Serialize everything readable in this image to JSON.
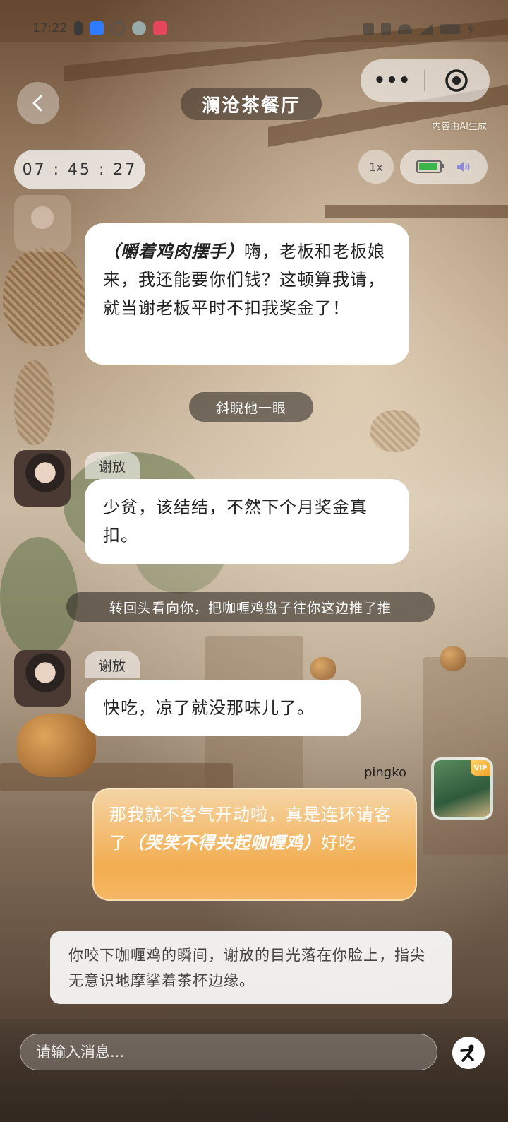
{
  "status_bar": {
    "time": "17:22"
  },
  "header": {
    "title": "澜沧茶餐厅",
    "menu_dots": "•••",
    "ai_note": "内容由AI生成"
  },
  "playback": {
    "timer": "07 : 45 : 27",
    "speed": "1x"
  },
  "messages": {
    "m1_text_italic": "（嚼着鸡肉摆手）",
    "m1_text": "嗨，老板和老板娘来，我还能要你们钱？这顿算我请，就当谢老板平时不扣我奖金了！",
    "narr1": "斜睨他一眼",
    "m2_name": "谢放",
    "m2_text": "少贫，该结结，不然下个月奖金真扣。",
    "narr2": "转回头看向你，把咖喱鸡盘子往你这边推了推",
    "m3_name": "谢放",
    "m3_text": "快吃，凉了就没那味儿了。"
  },
  "user_message": {
    "name": "pingko",
    "vip": "VIP",
    "text1": "那我就不客气开动啦，真是连环请客了",
    "text_italic": "（哭笑不得夹起咖喱鸡）",
    "text2": "好吃"
  },
  "scene_description": "你咬下咖喱鸡的瞬间，谢放的目光落在你脸上，指尖无意识地摩挲着茶杯边缘。",
  "input": {
    "placeholder": "请输入消息..."
  },
  "icons": {
    "back": "chevron-left-icon",
    "target": "target-icon",
    "battery": "battery-icon",
    "speaker": "speaker-icon",
    "action": "person-action-icon"
  },
  "colors": {
    "user_bubble": "#f2ad4f",
    "bubble": "#ffffff",
    "narration": "#32302c"
  }
}
